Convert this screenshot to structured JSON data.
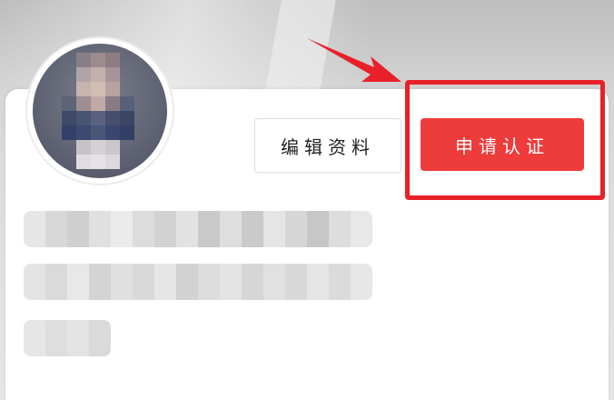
{
  "buttons": {
    "edit_profile_label": "编辑资料",
    "apply_certification_label": "申请认证"
  },
  "colors": {
    "primary_red": "#ee3b3b",
    "highlight_red": "#e8202a",
    "arrow_red": "#e8202a"
  },
  "icons": {
    "arrow": "pointer-arrow-icon"
  }
}
